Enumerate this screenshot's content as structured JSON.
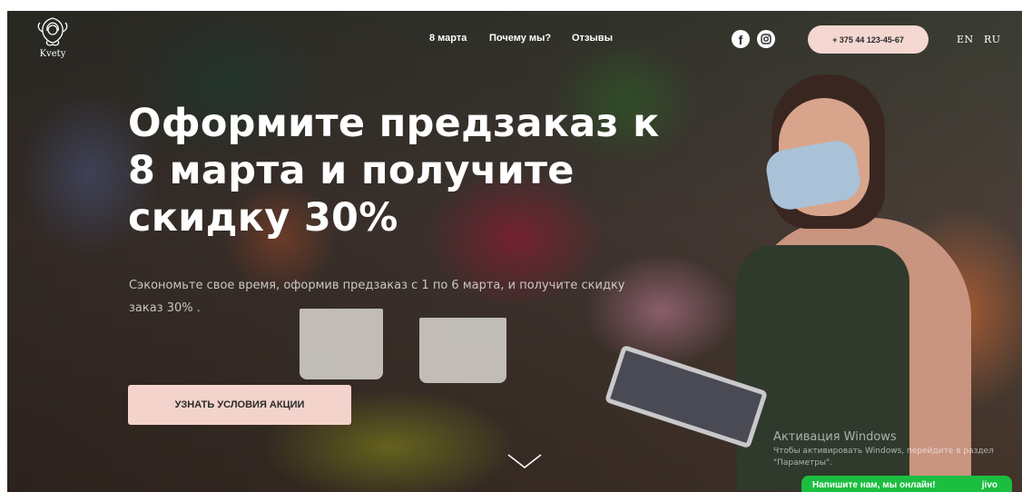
{
  "logo": {
    "text": "Kvety",
    "icon": "rose-logo-icon"
  },
  "nav": {
    "items": [
      "8 марта",
      "Почему мы?",
      "Отзывы"
    ]
  },
  "social": {
    "facebook_icon": "facebook-icon",
    "facebook_glyph": "f",
    "instagram_icon": "instagram-icon"
  },
  "phone": {
    "label": "+ 375 44 123-45-67"
  },
  "languages": [
    "EN",
    "RU"
  ],
  "hero": {
    "headline_lines": [
      "Оформите предзаказ к",
      "8 марта и получите",
      "скидку 30%"
    ],
    "subtitle_lines": [
      "Сэкономьте свое время, оформив предзаказ с 1 по 6 марта, и получите скидку",
      "заказ 30% ."
    ],
    "cta_label": "УЗНАТЬ УСЛОВИЯ АКЦИИ",
    "scroll_icon": "chevron-down-icon"
  },
  "windows_watermark": {
    "title": "Активация Windows",
    "text_lines": [
      "Чтобы активировать Windows, перейдите в раздел",
      "\"Параметры\"."
    ]
  },
  "chat": {
    "label": "Напишите нам, мы онлайн!",
    "brand": "jivo"
  },
  "colors": {
    "accent_pink": "#f3d7d0",
    "chat_green": "#1cbe40",
    "text_white": "#ffffff"
  }
}
